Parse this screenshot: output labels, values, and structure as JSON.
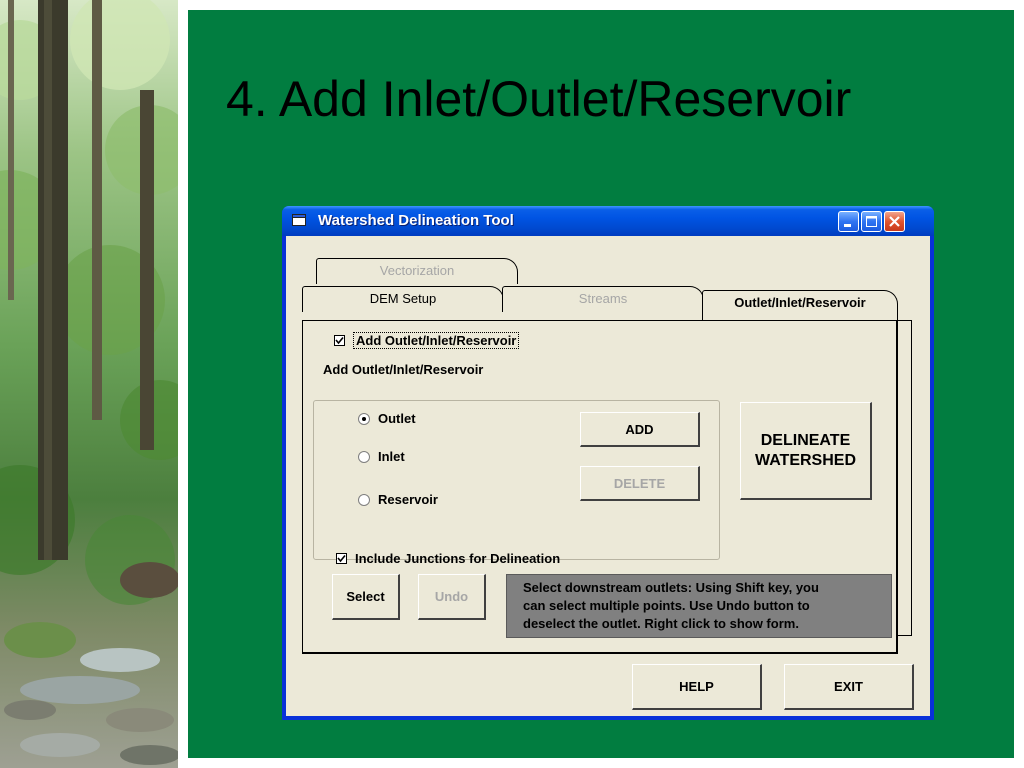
{
  "slide": {
    "title": "4. Add Inlet/Outlet/Reservoir"
  },
  "window": {
    "title": "Watershed Delineation Tool",
    "controls": [
      "minimize",
      "maximize",
      "close"
    ]
  },
  "tabs": {
    "vectorization": "Vectorization",
    "dem_setup": "DEM Setup",
    "streams": "Streams",
    "outlet": "Outlet/Inlet/Reservoir"
  },
  "panel": {
    "add_checkbox": {
      "label": "Add Outlet/Inlet/Reservoir",
      "checked": true
    },
    "group_label": "Add Outlet/Inlet/Reservoir",
    "radios": [
      {
        "label": "Outlet",
        "selected": true
      },
      {
        "label": "Inlet",
        "selected": false
      },
      {
        "label": "Reservoir",
        "selected": false
      }
    ],
    "add_button": "ADD",
    "delete_button": "DELETE",
    "delineate_button_line1": "DELINEATE",
    "delineate_button_line2": "WATERSHED",
    "junctions_checkbox": {
      "label": "Include Junctions for Delineation",
      "checked": true
    },
    "select_button": "Select",
    "undo_button": "Undo",
    "message_lines": [
      "Select downstream outlets: Using Shift key, you",
      "can select multiple points. Use Undo button to",
      "deselect the outlet. Right click to show form."
    ]
  },
  "footer": {
    "help_button": "HELP",
    "exit_button": "EXIT"
  },
  "colors": {
    "slide_background": "#017d40",
    "titlebar": "#0054e3",
    "dialog": "#ece9d8",
    "message_box": "#808080"
  }
}
